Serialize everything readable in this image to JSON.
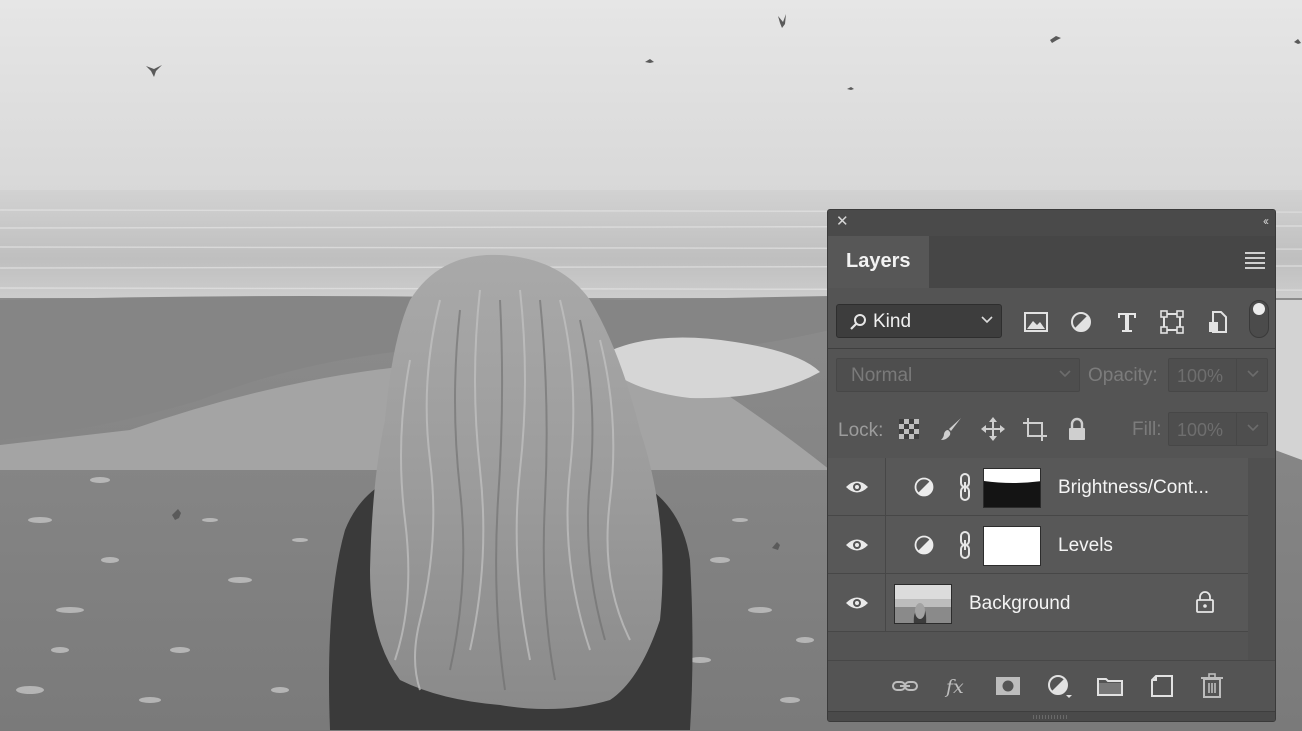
{
  "photo": {
    "description_icon": "beach-photo",
    "colors": {
      "sky": "#e2e2e2",
      "sea": "#bdbdbd",
      "sand": "#8d8d8d",
      "hair": "#a7a7a7",
      "jacket": "#3c3c3c"
    }
  },
  "panel": {
    "title_close_icon": "close-icon",
    "title_collapse_icon": "collapse-icon",
    "tab_label": "Layers",
    "menu_icon": "panel-menu-icon",
    "filter": {
      "kind_label": "Kind",
      "icons": [
        "pixel-layer-filter-icon",
        "adjustment-layer-filter-icon",
        "type-layer-filter-icon",
        "shape-layer-filter-icon",
        "smart-object-filter-icon"
      ],
      "toggle_on": true
    },
    "blend": {
      "mode": "Normal",
      "opacity_label": "Opacity:",
      "opacity_value": "100%"
    },
    "lock": {
      "label": "Lock:",
      "icons": [
        "lock-transparent-pixels-icon",
        "lock-image-pixels-icon",
        "lock-position-icon",
        "lock-artboard-icon",
        "lock-all-icon"
      ],
      "fill_label": "Fill:",
      "fill_value": "100%"
    },
    "layers": [
      {
        "name": "Brightness/Cont...",
        "type": "adjustment",
        "visible": true
      },
      {
        "name": "Levels",
        "type": "adjustment",
        "visible": true
      },
      {
        "name": "Background",
        "type": "image",
        "visible": true,
        "locked": true
      }
    ],
    "toolbar_icons": [
      "link-layers-icon",
      "layer-style-icon",
      "add-mask-icon",
      "new-adjustment-layer-icon",
      "new-group-icon",
      "new-layer-icon",
      "delete-layer-icon"
    ],
    "colors": {
      "panel_bg": "#545454",
      "header_bg": "#464646",
      "text": "#f4f4f4",
      "disabled_text": "#7c7c7c"
    }
  }
}
